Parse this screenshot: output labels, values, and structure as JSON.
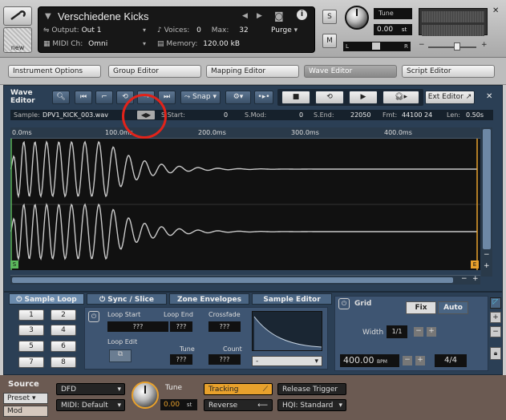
{
  "header": {
    "new_label": "new",
    "instrument_name": "Verschiedene Kicks",
    "output_label": "Output:",
    "output_value": "Out 1",
    "voices_label": "Voices:",
    "voices_value": "0",
    "max_label": "Max:",
    "max_value": "32",
    "purge_label": "Purge",
    "midi_label": "MIDI Ch:",
    "midi_value": "Omni",
    "memory_label": "Memory:",
    "memory_value": "120.00 kB",
    "solo_label": "S",
    "mute_label": "M",
    "tune_label": "Tune",
    "tune_value": "0.00",
    "tune_unit": "st",
    "pan_l": "L",
    "pan_r": "R"
  },
  "tabs": [
    "Instrument Options",
    "Group Editor",
    "Mapping Editor",
    "Wave Editor",
    "Script Editor"
  ],
  "wave_editor": {
    "title_line1": "Wave",
    "title_line2": "Editor",
    "snap_label": "Snap",
    "ext_editor_label": "Ext Editor",
    "sample_label": "Sample:",
    "sample_name": "DPV1_KICK_003.wav",
    "sstart_label": "S.Start:",
    "sstart_value": "0",
    "smod_label": "S.Mod:",
    "smod_value": "0",
    "send_label": "S.End:",
    "send_value": "22050",
    "fmt_label": "Fmt:",
    "fmt_value": "44100  24",
    "len_label": "Len:",
    "len_value": "0.50s",
    "ruler": [
      "0.0ms",
      "100.0ms",
      "200.0ms",
      "300.0ms",
      "400.0ms"
    ],
    "start_marker": "S",
    "end_marker": "E"
  },
  "panel": {
    "tabs": [
      "Sample Loop",
      "Sync / Slice",
      "Zone Envelopes",
      "Sample Editor"
    ],
    "loop_numbers": [
      "1",
      "2",
      "3",
      "4",
      "5",
      "6",
      "7",
      "8"
    ],
    "loop_start_label": "Loop Start",
    "loop_end_label": "Loop End",
    "crossfade_label": "Crossfade",
    "loop_edit_label": "Loop Edit",
    "tune_label": "Tune",
    "count_label": "Count",
    "unknown_value": "???",
    "dropdown_value": "-",
    "grid_label": "Grid",
    "fix_label": "Fix",
    "auto_label": "Auto",
    "width_label": "Width",
    "width_value": "1/1",
    "bpm_value": "400.00",
    "bpm_unit": "BPM",
    "time_sig": "4/4"
  },
  "source": {
    "title": "Source",
    "preset_label": "Preset",
    "mod_label": "Mod",
    "mode_value": "DFD",
    "midi_value": "MIDI: Default",
    "tune_label": "Tune",
    "tune_value": "0.00",
    "tune_unit": "st",
    "tracking_label": "Tracking",
    "reverse_label": "Reverse",
    "release_trigger_label": "Release Trigger",
    "hqi_value": "HQI: Standard"
  },
  "colors": {
    "accent_orange": "#e8a12c",
    "waveform": "#c9c9c9",
    "annotation_circle": "#e2231a"
  }
}
